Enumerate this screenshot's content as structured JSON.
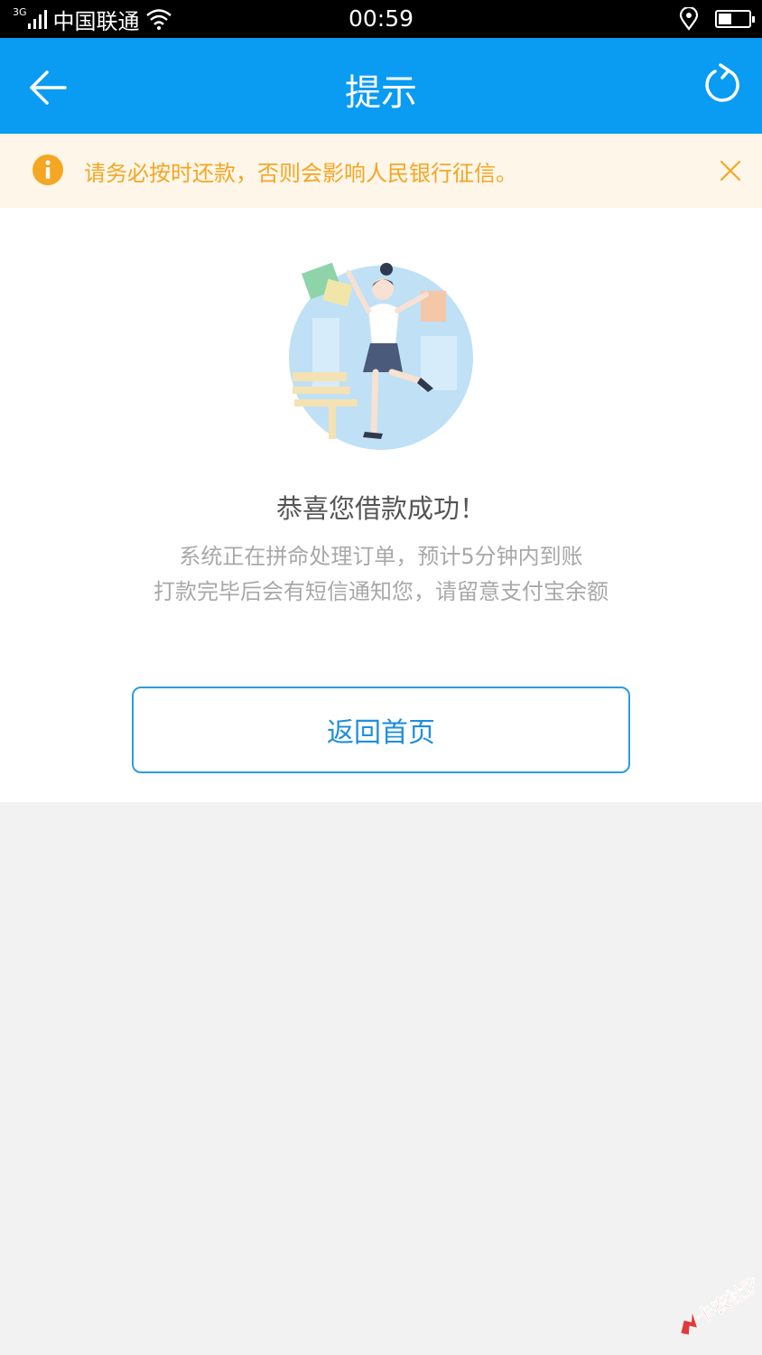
{
  "status_bar": {
    "network_type": "3G",
    "carrier": "中国联通",
    "time": "00:59",
    "battery_level": 0.45
  },
  "nav": {
    "title": "提示",
    "back_icon": "back-arrow-icon",
    "refresh_icon": "refresh-icon",
    "color": "#0a9bf2"
  },
  "notice": {
    "text": "请务必按时还款，否则会影响人民银行征信。",
    "icon": "info-icon",
    "close_icon": "close-icon",
    "color": "#f5a623"
  },
  "main": {
    "headline": "恭喜您借款成功！",
    "description_line1": "系统正在拼命处理订单，预计5分钟内到账",
    "description_line2": "打款完毕后会有短信通知您，请留意支付宝余额",
    "home_button": "返回首页"
  },
  "watermark": {
    "text": "卡农社区",
    "color": "#e03a3a"
  }
}
